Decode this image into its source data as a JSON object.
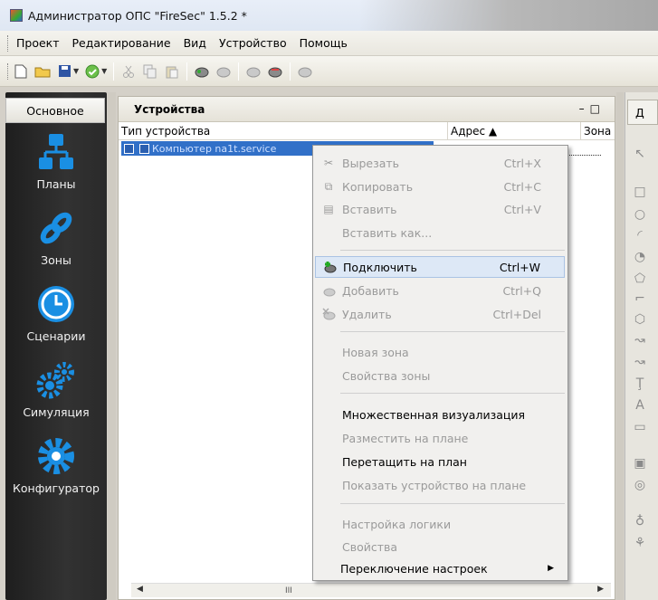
{
  "window": {
    "title": "Администратор ОПС \"FireSec\" 1.5.2 *"
  },
  "menubar": {
    "items": [
      "Проект",
      "Редактирование",
      "Вид",
      "Устройство",
      "Помощь"
    ]
  },
  "leftnav": {
    "header": "Основное",
    "items": [
      {
        "label": "Планы",
        "icon": "plans-icon"
      },
      {
        "label": "Зоны",
        "icon": "zones-icon"
      },
      {
        "label": "Сценарии",
        "icon": "scenarios-icon"
      },
      {
        "label": "Симуляция",
        "icon": "simulation-icon"
      },
      {
        "label": "Конфигуратор",
        "icon": "configurator-icon"
      }
    ]
  },
  "devices_panel": {
    "title": "Устройства",
    "controls": [
      "–",
      "□"
    ],
    "columns": [
      "Тип устройства",
      "Адрес ▲",
      "Зона"
    ],
    "rows": [
      {
        "name": "Компьютер na1t.service"
      }
    ],
    "scroll_thumb": "III"
  },
  "right_panel": {
    "tab_label": "Д"
  },
  "context_menu": {
    "items": [
      {
        "label": "Вырезать",
        "shortcut": "Ctrl+X",
        "icon": "scissors-icon",
        "disabled": true
      },
      {
        "label": "Копировать",
        "shortcut": "Ctrl+C",
        "icon": "copy-icon",
        "disabled": true
      },
      {
        "label": "Вставить",
        "shortcut": "Ctrl+V",
        "icon": "paste-icon",
        "disabled": true
      },
      {
        "label": "Вставить как...",
        "shortcut": "",
        "disabled": true
      },
      {
        "label": "Подключить",
        "shortcut": "Ctrl+W",
        "icon": "connect-device-icon",
        "disabled": false,
        "highlighted": true
      },
      {
        "label": "Добавить",
        "shortcut": "Ctrl+Q",
        "icon": "add-device-icon",
        "disabled": true
      },
      {
        "label": "Удалить",
        "shortcut": "Ctrl+Del",
        "icon": "delete-device-icon",
        "disabled": true
      },
      {
        "label": "Новая зона",
        "disabled": true
      },
      {
        "label": "Свойства зоны",
        "disabled": true
      },
      {
        "label": "Множественная визуализация",
        "disabled": false
      },
      {
        "label": "Разместить на плане",
        "disabled": true
      },
      {
        "label": "Перетащить на план",
        "disabled": false
      },
      {
        "label": "Показать устройство на плане",
        "disabled": true
      },
      {
        "label": "Настройка логики",
        "disabled": true
      },
      {
        "label": "Свойства",
        "disabled": true
      },
      {
        "label": "Переключение настроек",
        "disabled": false,
        "submenu": true
      }
    ]
  },
  "colors": {
    "accent_selection": "#3170c8",
    "nav_background": "#2a2a2a",
    "nav_icon_blue": "#1f8fe0"
  }
}
